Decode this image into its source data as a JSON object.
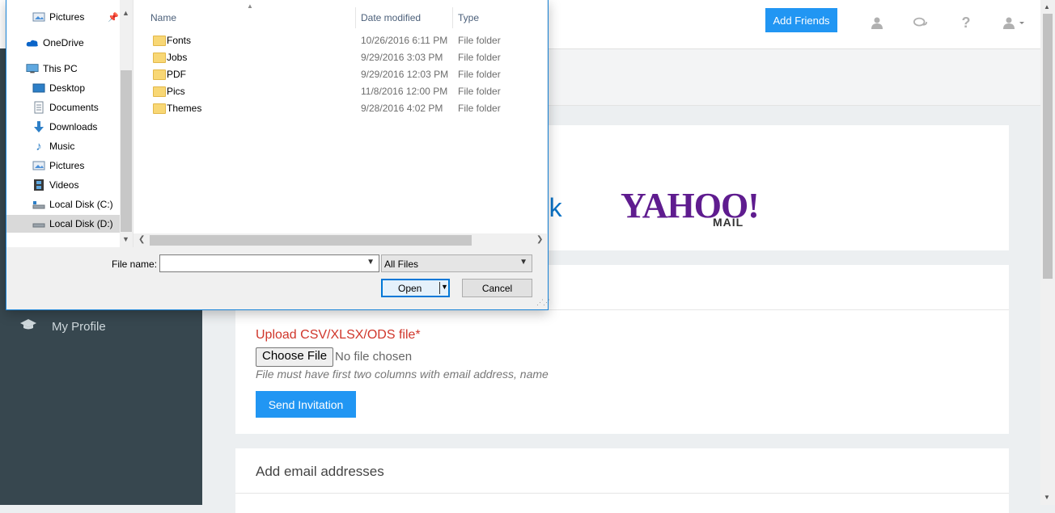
{
  "topbar": {
    "add_friends_label": "Add Friends"
  },
  "sidebar": {
    "items": [
      {
        "label": "My Profile",
        "icon": "graduation-cap-icon"
      }
    ]
  },
  "providers": {
    "outlook_fragment": "ook",
    "yahoo_word": "YAHOO!",
    "yahoo_sub": "MAIL"
  },
  "upload": {
    "label": "Upload CSV/XLSX/ODS file*",
    "choose_file_label": "Choose File",
    "no_file_text": "No file chosen",
    "hint": "File must have first two columns with email address, name",
    "send_label": "Send Invitation"
  },
  "emails": {
    "title": "Add email addresses"
  },
  "dialog": {
    "nav_items": [
      {
        "label": "Pictures",
        "icon": "pictures-icon",
        "pinned": true
      },
      {
        "label": "OneDrive",
        "icon": "onedrive-icon"
      },
      {
        "label": "This PC",
        "icon": "this-pc-icon"
      },
      {
        "label": "Desktop",
        "icon": "desktop-icon"
      },
      {
        "label": "Documents",
        "icon": "documents-icon"
      },
      {
        "label": "Downloads",
        "icon": "downloads-icon"
      },
      {
        "label": "Music",
        "icon": "music-icon"
      },
      {
        "label": "Pictures",
        "icon": "pictures-icon"
      },
      {
        "label": "Videos",
        "icon": "videos-icon"
      },
      {
        "label": "Local Disk (C:)",
        "icon": "local-disk-icon"
      },
      {
        "label": "Local Disk (D:)",
        "icon": "local-disk-icon",
        "selected": true
      }
    ],
    "columns": {
      "name": "Name",
      "date": "Date modified",
      "type": "Type"
    },
    "files": [
      {
        "name": "Fonts",
        "date": "10/26/2016 6:11 PM",
        "type": "File folder"
      },
      {
        "name": "Jobs",
        "date": "9/29/2016 3:03 PM",
        "type": "File folder"
      },
      {
        "name": "PDF",
        "date": "9/29/2016 12:03 PM",
        "type": "File folder"
      },
      {
        "name": "Pics",
        "date": "11/8/2016 12:00 PM",
        "type": "File folder"
      },
      {
        "name": "Themes",
        "date": "9/28/2016 4:02 PM",
        "type": "File folder"
      }
    ],
    "file_name_label": "File name:",
    "file_name_value": "",
    "filter_value": "All Files",
    "open_label": "Open",
    "cancel_label": "Cancel"
  },
  "colors": {
    "accent": "#2196f3",
    "sidebar": "#37474f",
    "error": "#d0362b",
    "yahoo": "#5f1c8f",
    "outlook": "#0a72c6"
  }
}
